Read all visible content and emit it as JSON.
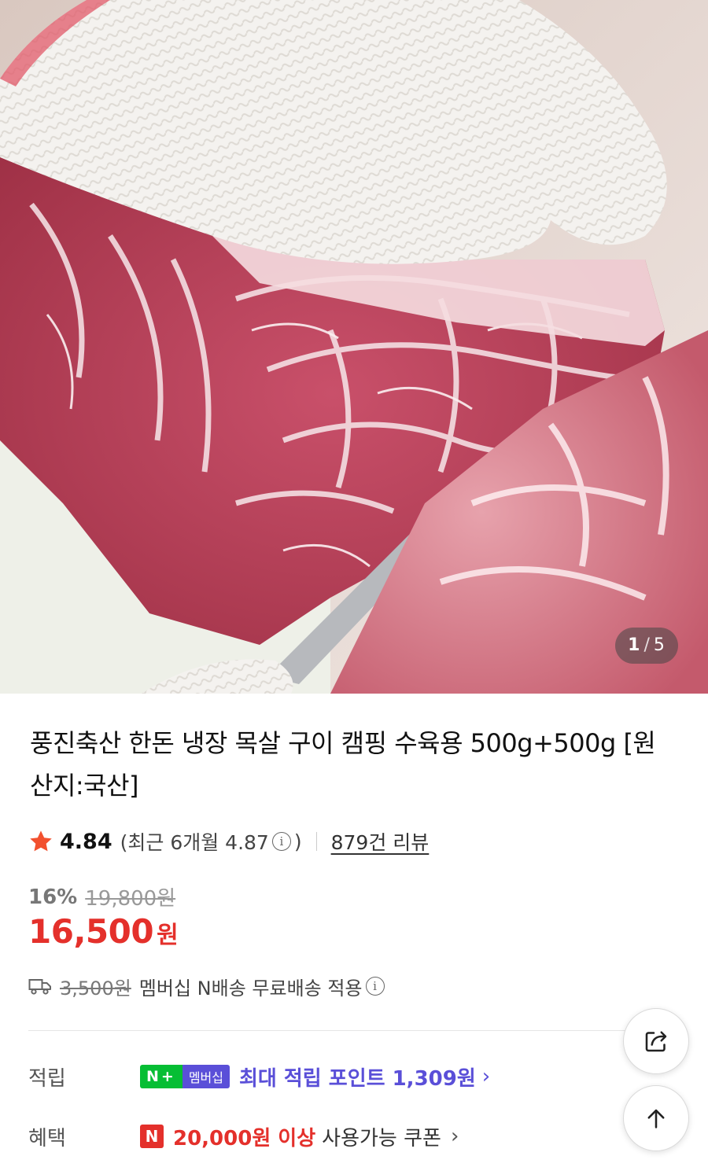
{
  "gallery": {
    "current": "1",
    "separator": "/",
    "total": "5"
  },
  "product": {
    "title": "풍진축산 한돈 냉장 목살 구이 캠핑 수육용 500g+500g [원산지:국산]"
  },
  "rating": {
    "score": "4.84",
    "recent": "(최근 6개월 4.87",
    "recent_close": ")",
    "review_count": "879건 리뷰"
  },
  "price": {
    "discount": "16%",
    "original": "19,800원",
    "sale": "16,500",
    "currency": "원"
  },
  "shipping": {
    "original_fee": "3,500원",
    "text": "멤버십 N배송 무료배송 적용"
  },
  "benefits": {
    "points_label": "적립",
    "npay_n": "N",
    "npay_plus": "+",
    "membership_badge": "멤버십",
    "points_text": "최대 적립 포인트 1,309원",
    "benefit_label": "혜택",
    "coupon_badge": "N",
    "coupon_highlight": "20,000원 이상",
    "coupon_text": "사용가능 쿠폰"
  },
  "icons": {
    "rating": "star-icon",
    "info": "info-icon",
    "shipping": "truck-icon",
    "share": "share-icon",
    "scroll_top": "arrow-up-icon"
  },
  "colors": {
    "price_red": "#e4302b",
    "npay_green": "#06be34",
    "membership_purple": "#5a4fd8"
  }
}
